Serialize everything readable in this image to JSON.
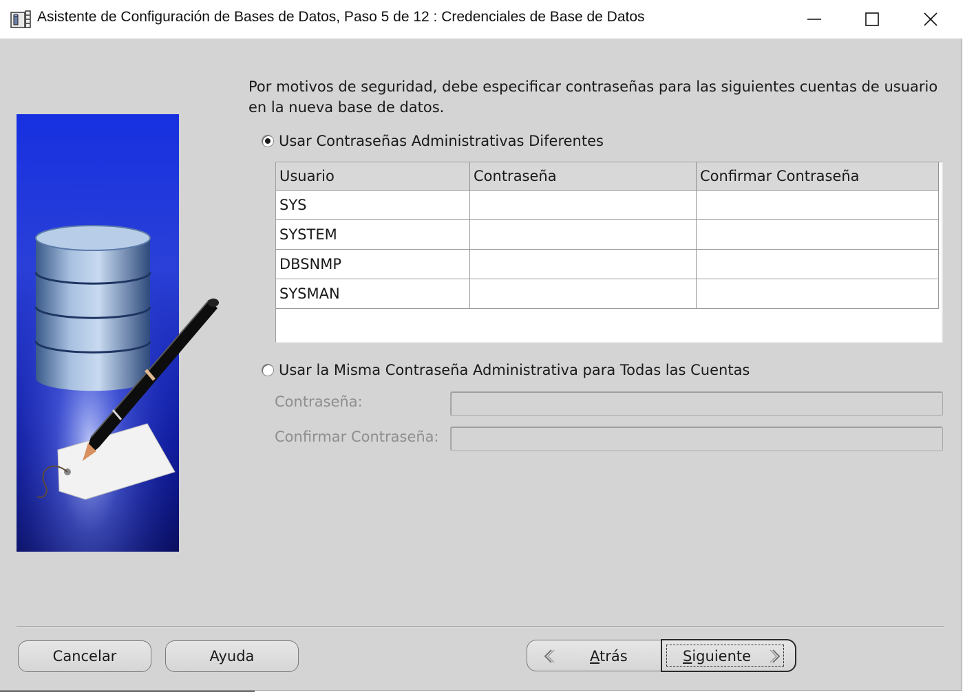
{
  "window": {
    "title": "Asistente de Configuración de Bases de Datos, Paso 5 de 12 : Credenciales de Base de Datos",
    "controls": {
      "minimize": "minimize-icon",
      "maximize": "maximize-icon",
      "close": "close-icon"
    }
  },
  "intro_text": "Por motivos de seguridad, debe especificar contraseñas para las siguientes cuentas de usuario en la nueva base de datos.",
  "option_different": {
    "label": "Usar Contraseñas Administrativas Diferentes",
    "selected": true
  },
  "table": {
    "headers": [
      "Usuario",
      "Contraseña",
      "Confirmar Contraseña"
    ],
    "rows": [
      {
        "user": "SYS",
        "password": "",
        "confirm": ""
      },
      {
        "user": "SYSTEM",
        "password": "",
        "confirm": ""
      },
      {
        "user": "DBSNMP",
        "password": "",
        "confirm": ""
      },
      {
        "user": "SYSMAN",
        "password": "",
        "confirm": ""
      }
    ]
  },
  "option_same": {
    "label": "Usar la Misma Contraseña Administrativa para Todas las Cuentas",
    "selected": false,
    "password_label": "Contraseña:",
    "confirm_label": "Confirmar Contraseña:",
    "password_value": "",
    "confirm_value": ""
  },
  "buttons": {
    "cancel": "Cancelar",
    "help": "Ayuda",
    "back_mnemonic": "A",
    "back_rest": "trás",
    "next_mnemonic": "S",
    "next_rest": "iguiente"
  },
  "colors": {
    "art_blue": "#1e2fd0",
    "art_dark": "#0a0f6a",
    "window_bg": "#d4d4d4"
  }
}
